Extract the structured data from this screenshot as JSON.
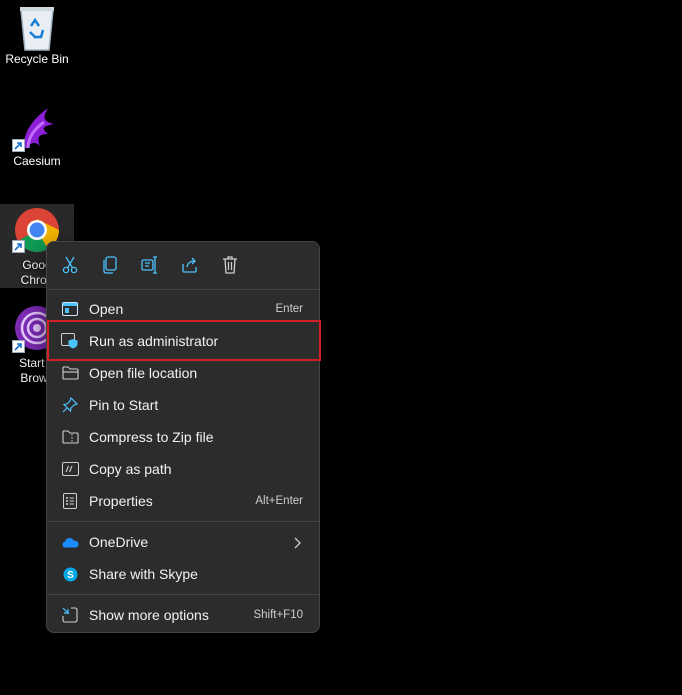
{
  "desktop": {
    "icons": [
      {
        "label": "Recycle Bin"
      },
      {
        "label": "Caesium"
      },
      {
        "label_line1": "Goog",
        "label_line2": "Chron"
      },
      {
        "label_line1": "Start T",
        "label_line2": "Brows"
      }
    ]
  },
  "context_menu": {
    "toolbar": [
      "cut-icon",
      "copy-icon",
      "rename-icon",
      "share-icon",
      "delete-icon"
    ],
    "items": [
      {
        "label": "Open",
        "shortcut": "Enter",
        "icon": "open-app-icon"
      },
      {
        "label": "Run as administrator",
        "shortcut": "",
        "icon": "admin-shield-icon"
      },
      {
        "label": "Open file location",
        "shortcut": "",
        "icon": "folder-icon"
      },
      {
        "label": "Pin to Start",
        "shortcut": "",
        "icon": "pin-icon"
      },
      {
        "label": "Compress to Zip file",
        "shortcut": "",
        "icon": "zip-folder-icon"
      },
      {
        "label": "Copy as path",
        "shortcut": "",
        "icon": "path-icon"
      },
      {
        "label": "Properties",
        "shortcut": "Alt+Enter",
        "icon": "properties-icon"
      },
      {
        "label": "OneDrive",
        "shortcut": "",
        "icon": "onedrive-icon"
      },
      {
        "label": "Share with Skype",
        "shortcut": "",
        "icon": "skype-icon"
      },
      {
        "label": "Show more options",
        "shortcut": "Shift+F10",
        "icon": "more-options-icon"
      }
    ]
  },
  "colors": {
    "accent": "#4cc2ff",
    "highlight_border": "#d21f26",
    "menu_bg": "#2c2c2c"
  }
}
